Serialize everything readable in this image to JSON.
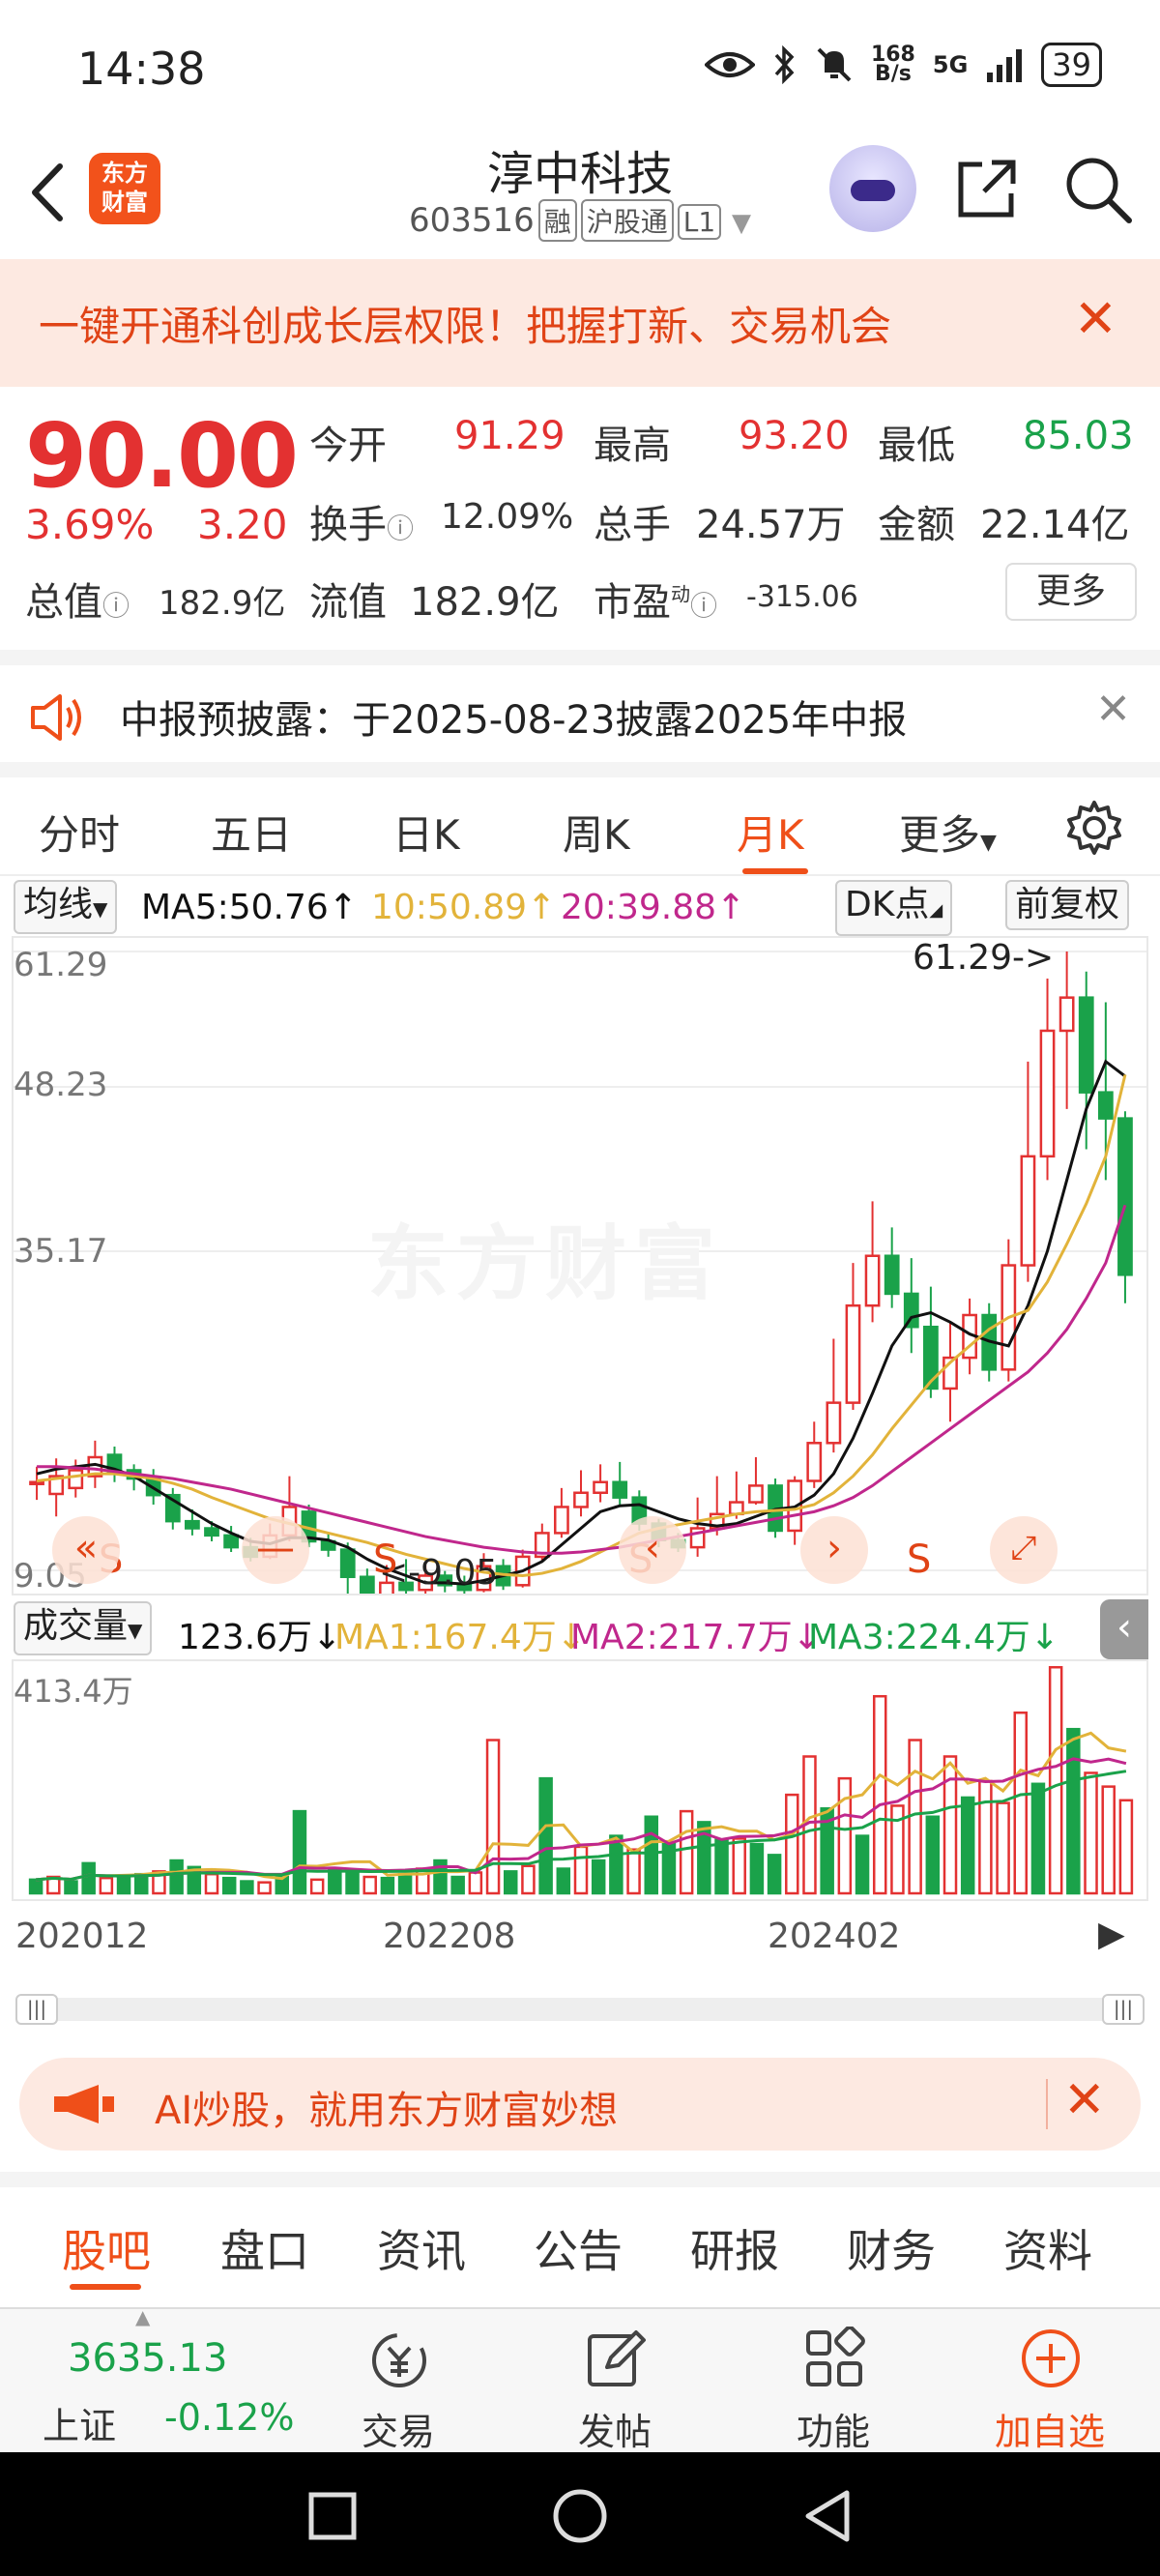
{
  "status_bar": {
    "time": "14:38",
    "net_speed_top": "168",
    "net_speed_bottom": "B/s",
    "network": "5G",
    "battery": "39"
  },
  "header": {
    "logo_text_line1": "东方",
    "logo_text_line2": "财富",
    "stock_name": "淳中科技",
    "stock_code": "603516",
    "tag_margin": "融",
    "tag_connect": "沪股通",
    "tag_level": "L1"
  },
  "promo_banner": {
    "text": "一键开通科创成长层权限！把握打新、交易机会"
  },
  "quote": {
    "price": "90.00",
    "change_pct": "3.69%",
    "change_amt": "3.20",
    "open_label": "今开",
    "open_value": "91.29",
    "high_label": "最高",
    "high_value": "93.20",
    "low_label": "最低",
    "low_value": "85.03",
    "turnover_label": "换手",
    "turnover_value": "12.09%",
    "volume_label": "总手",
    "volume_value": "24.57万",
    "amount_label": "金额",
    "amount_value": "22.14亿",
    "mcap_label": "总值",
    "mcap_value": "182.9亿",
    "float_label": "流值",
    "float_value": "182.9亿",
    "pe_label": "市盈",
    "pe_sup": "动",
    "pe_value": "-315.06",
    "more_button": "更多"
  },
  "notice": {
    "text": "中报预披露：于2025-08-23披露2025年中报"
  },
  "chart_tabs": [
    "分时",
    "五日",
    "日K",
    "周K",
    "月K",
    "更多"
  ],
  "chart_toolbar": {
    "indicator": "均线",
    "ma5": "MA5:50.76",
    "ma10": "10:50.89",
    "ma20": "20:39.88",
    "dk_button": "DK点",
    "adjust_button": "前复权"
  },
  "kchart": {
    "y_labels": [
      "61.29",
      "48.23",
      "35.17",
      "9.05"
    ],
    "max_label": "61.29->",
    "min_label": "<-9.05",
    "watermark": "东方财富",
    "signal_marks": [
      "S",
      "S",
      "S",
      "S"
    ],
    "colors": {
      "up": "#e33131",
      "down": "#1aa24a",
      "ma5": "#111111",
      "ma10": "#e2b33a",
      "ma20": "#c0278c"
    }
  },
  "volume_toolbar": {
    "indicator": "成交量",
    "vol": "123.6万",
    "ma1": "MA1:167.4万",
    "ma2": "MA2:217.7万",
    "ma3": "MA3:224.4万"
  },
  "vchart": {
    "y_label": "413.4万"
  },
  "x_axis": [
    "202012",
    "202208",
    "202402"
  ],
  "ai_banner": {
    "text": "AI炒股，就用东方财富妙想"
  },
  "sub_tabs": [
    "股吧",
    "盘口",
    "资讯",
    "公告",
    "研报",
    "财务",
    "资料"
  ],
  "bottom_bar": {
    "index_value": "3635.13",
    "index_name": "上证",
    "index_change": "-0.12%",
    "trade": "交易",
    "post": "发帖",
    "function": "功能",
    "add_watch": "加自选"
  },
  "chart_data": {
    "type": "candlestick",
    "title": "",
    "xlabel": "",
    "ylabel": "",
    "ylim": [
      9.05,
      61.29
    ],
    "x_ticks": [
      "202012",
      "202208",
      "202402"
    ],
    "candles": [
      {
        "o": 16.5,
        "c": 16.5,
        "h": 17.8,
        "l": 15.0
      },
      {
        "o": 15.5,
        "c": 17.0,
        "h": 18.5,
        "l": 13.6
      },
      {
        "o": 16.0,
        "c": 17.5,
        "h": 18.4,
        "l": 15.2
      },
      {
        "o": 17.0,
        "c": 18.6,
        "h": 20.0,
        "l": 16.0
      },
      {
        "o": 18.8,
        "c": 17.2,
        "h": 19.5,
        "l": 16.5
      },
      {
        "o": 17.5,
        "c": 16.8,
        "h": 18.0,
        "l": 15.8
      },
      {
        "o": 16.8,
        "c": 15.4,
        "h": 17.6,
        "l": 14.6
      },
      {
        "o": 15.4,
        "c": 13.2,
        "h": 16.0,
        "l": 12.5
      },
      {
        "o": 13.2,
        "c": 12.6,
        "h": 14.2,
        "l": 12.0
      },
      {
        "o": 12.6,
        "c": 12.0,
        "h": 13.2,
        "l": 11.5
      },
      {
        "o": 12.0,
        "c": 11.0,
        "h": 12.8,
        "l": 10.6
      },
      {
        "o": 11.0,
        "c": 10.2,
        "h": 11.8,
        "l": 9.8
      },
      {
        "o": 10.2,
        "c": 12.0,
        "h": 13.0,
        "l": 10.0
      },
      {
        "o": 12.0,
        "c": 14.4,
        "h": 17.0,
        "l": 11.5
      },
      {
        "o": 14.0,
        "c": 11.5,
        "h": 14.6,
        "l": 11.0
      },
      {
        "o": 11.5,
        "c": 10.8,
        "h": 12.2,
        "l": 10.2
      },
      {
        "o": 10.8,
        "c": 8.5,
        "h": 11.4,
        "l": 7.0
      },
      {
        "o": 8.5,
        "c": 6.8,
        "h": 9.2,
        "l": 5.6
      },
      {
        "o": 6.8,
        "c": 8.0,
        "h": 9.5,
        "l": 6.4
      },
      {
        "o": 8.0,
        "c": 7.4,
        "h": 10.0,
        "l": 7.0
      },
      {
        "o": 7.4,
        "c": 8.6,
        "h": 9.5,
        "l": 7.0
      },
      {
        "o": 8.6,
        "c": 7.8,
        "h": 9.0,
        "l": 7.2
      },
      {
        "o": 7.8,
        "c": 7.4,
        "h": 8.6,
        "l": 6.8
      },
      {
        "o": 7.4,
        "c": 9.4,
        "h": 10.5,
        "l": 7.2
      },
      {
        "o": 9.4,
        "c": 7.8,
        "h": 10.0,
        "l": 7.4
      },
      {
        "o": 7.8,
        "c": 10.2,
        "h": 10.8,
        "l": 7.6
      },
      {
        "o": 10.2,
        "c": 12.2,
        "h": 13.0,
        "l": 9.8
      },
      {
        "o": 12.2,
        "c": 14.4,
        "h": 16.0,
        "l": 11.8
      },
      {
        "o": 14.4,
        "c": 15.6,
        "h": 17.5,
        "l": 13.6
      },
      {
        "o": 15.6,
        "c": 16.5,
        "h": 18.0,
        "l": 14.8
      },
      {
        "o": 16.5,
        "c": 15.2,
        "h": 18.2,
        "l": 14.6
      },
      {
        "o": 15.2,
        "c": 13.0,
        "h": 15.8,
        "l": 12.4
      },
      {
        "o": 13.0,
        "c": 11.6,
        "h": 13.4,
        "l": 11.0
      },
      {
        "o": 11.6,
        "c": 11.0,
        "h": 12.2,
        "l": 10.6
      },
      {
        "o": 11.0,
        "c": 12.6,
        "h": 15.2,
        "l": 10.2
      },
      {
        "o": 12.6,
        "c": 13.8,
        "h": 17.0,
        "l": 12.0
      },
      {
        "o": 13.8,
        "c": 14.8,
        "h": 17.4,
        "l": 13.4
      },
      {
        "o": 14.8,
        "c": 16.2,
        "h": 18.6,
        "l": 14.6
      },
      {
        "o": 16.2,
        "c": 12.4,
        "h": 16.8,
        "l": 11.8
      },
      {
        "o": 12.4,
        "c": 16.6,
        "h": 17.0,
        "l": 11.2
      },
      {
        "o": 16.6,
        "c": 19.8,
        "h": 21.6,
        "l": 16.0
      },
      {
        "o": 19.8,
        "c": 23.2,
        "h": 28.6,
        "l": 19.0
      },
      {
        "o": 23.2,
        "c": 31.4,
        "h": 35.0,
        "l": 22.6
      },
      {
        "o": 31.4,
        "c": 35.6,
        "h": 40.2,
        "l": 30.0
      },
      {
        "o": 35.6,
        "c": 32.4,
        "h": 38.0,
        "l": 31.2
      },
      {
        "o": 32.4,
        "c": 29.6,
        "h": 35.4,
        "l": 27.4
      },
      {
        "o": 29.6,
        "c": 24.4,
        "h": 33.0,
        "l": 23.6
      },
      {
        "o": 24.4,
        "c": 27.0,
        "h": 30.0,
        "l": 21.6
      },
      {
        "o": 27.0,
        "c": 30.6,
        "h": 32.0,
        "l": 25.6
      },
      {
        "o": 30.6,
        "c": 26.0,
        "h": 31.6,
        "l": 25.0
      },
      {
        "o": 26.0,
        "c": 34.8,
        "h": 37.0,
        "l": 25.0
      },
      {
        "o": 34.8,
        "c": 44.0,
        "h": 52.0,
        "l": 33.4
      },
      {
        "o": 44.0,
        "c": 54.6,
        "h": 59.0,
        "l": 42.0
      },
      {
        "o": 54.6,
        "c": 57.4,
        "h": 61.29,
        "l": 48.0
      },
      {
        "o": 57.4,
        "c": 49.4,
        "h": 59.6,
        "l": 44.6
      },
      {
        "o": 49.4,
        "c": 47.2,
        "h": 57.0,
        "l": 42.0
      },
      {
        "o": 47.2,
        "c": 34.0,
        "h": 47.8,
        "l": 31.6
      }
    ],
    "series": [
      {
        "name": "MA5",
        "values": [
          17.2,
          17.6,
          17.8,
          18.0,
          17.6,
          17.0,
          16.0,
          15.0,
          14.0,
          13.0,
          12.2,
          11.5,
          11.3,
          11.8,
          11.8,
          11.6,
          11.0,
          10.0,
          9.2,
          8.6,
          8.0,
          8.0,
          7.9,
          8.2,
          8.6,
          9.0,
          9.8,
          11.2,
          12.6,
          14.0,
          14.5,
          14.6,
          14.0,
          13.4,
          13.0,
          12.8,
          13.0,
          13.6,
          14.2,
          14.4,
          15.4,
          17.2,
          20.2,
          24.0,
          28.0,
          30.4,
          30.8,
          30.0,
          29.0,
          28.4,
          28.0,
          31.4,
          36.0,
          42.0,
          48.0,
          52.0,
          50.76
        ]
      },
      {
        "name": "MA10",
        "values": [
          16.6,
          16.8,
          17.0,
          17.2,
          17.2,
          17.0,
          16.8,
          16.4,
          15.9,
          15.2,
          14.6,
          14.0,
          13.4,
          13.0,
          12.6,
          12.2,
          11.8,
          11.4,
          10.9,
          10.4,
          10.0,
          9.6,
          9.2,
          8.9,
          8.7,
          8.6,
          8.8,
          9.2,
          9.8,
          10.6,
          11.4,
          12.2,
          12.6,
          12.9,
          13.2,
          13.5,
          13.8,
          14.0,
          14.1,
          14.2,
          14.6,
          15.6,
          17.0,
          18.8,
          21.0,
          23.0,
          25.0,
          26.6,
          28.0,
          29.4,
          30.4,
          31.0,
          33.4,
          36.6,
          40.0,
          44.0,
          50.89
        ]
      },
      {
        "name": "MA20",
        "values": [
          17.8,
          17.8,
          17.7,
          17.6,
          17.4,
          17.2,
          17.0,
          16.8,
          16.5,
          16.2,
          15.9,
          15.5,
          15.1,
          14.7,
          14.3,
          13.9,
          13.5,
          13.1,
          12.7,
          12.3,
          11.9,
          11.6,
          11.3,
          11.0,
          10.8,
          10.6,
          10.5,
          10.5,
          10.6,
          10.8,
          11.0,
          11.3,
          11.6,
          11.9,
          12.2,
          12.5,
          12.8,
          13.1,
          13.4,
          13.7,
          14.0,
          14.5,
          15.2,
          16.2,
          17.4,
          18.6,
          19.8,
          21.0,
          22.2,
          23.4,
          24.6,
          25.8,
          27.4,
          29.4,
          32.0,
          35.0,
          39.88
        ]
      }
    ],
    "volume": {
      "ylim": [
        0,
        413.4
      ],
      "bars": [
        25,
        30,
        22,
        55,
        28,
        30,
        35,
        40,
        60,
        48,
        35,
        28,
        22,
        20,
        30,
        150,
        25,
        45,
        38,
        30,
        28,
        35,
        45,
        60,
        30,
        38,
        280,
        40,
        50,
        210,
        45,
        85,
        60,
        105,
        80,
        140,
        90,
        150,
        130,
        98,
        100,
        90,
        70,
        180,
        250,
        155,
        210,
        105,
        360,
        160,
        280,
        140,
        250,
        175,
        205,
        165,
        330,
        200,
        413,
        300,
        220,
        195,
        170
      ]
    }
  }
}
